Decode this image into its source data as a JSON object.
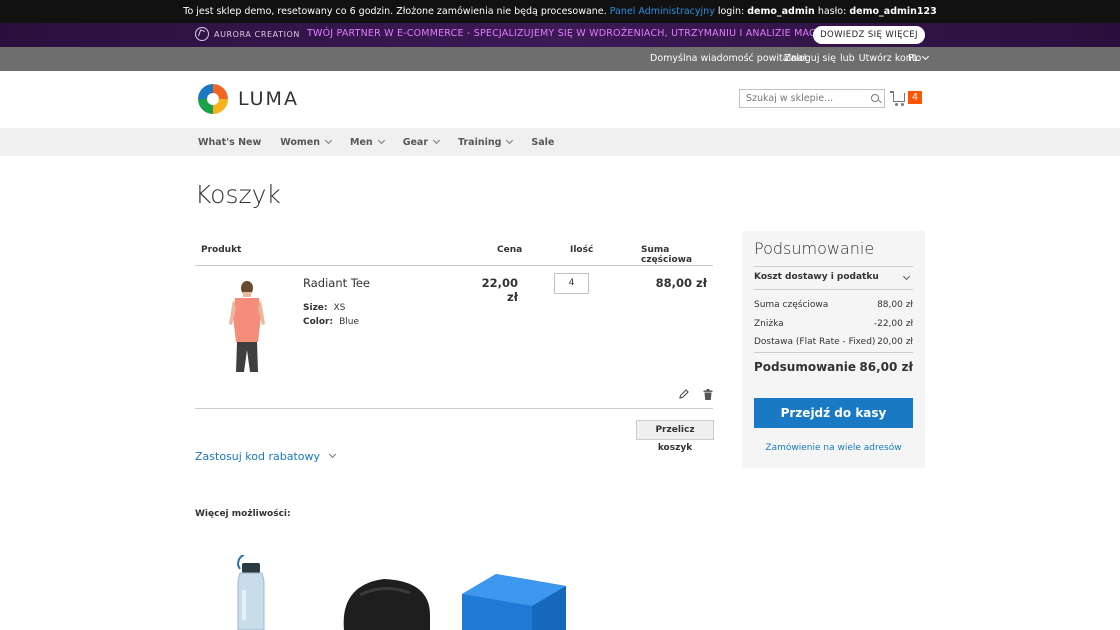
{
  "demo_notice": {
    "text_before": "To jest sklep demo, resetowany co 6 godzin. Złożone zamówienia nie będą procesowane.",
    "admin_link": "Panel Administracyjny",
    "login_label": "login:",
    "login_value": "demo_admin",
    "password_label": "hasło:",
    "password_value": "demo_admin123"
  },
  "promo": {
    "brand": "AURORA CREATION",
    "text": "TWÓJ PARTNER W E-COMMERCE - SPECJALIZUJEMY SIĘ W WDROŻENIACH, UTRZYMANIU I ANALIZIE MAGENTO",
    "button": "DOWIEDZ SIĘ WIĘCEJ"
  },
  "panel": {
    "welcome": "Domyślna wiadomość powitalna!",
    "sign_in": "Zaloguj się",
    "or": "lub",
    "create_account": "Utwórz konto",
    "language": "PL"
  },
  "header": {
    "logo_text": "LUMA",
    "search_placeholder": "Szukaj w sklepie...",
    "cart_count": "4"
  },
  "nav": {
    "items": [
      {
        "label": "What's New",
        "has_submenu": false
      },
      {
        "label": "Women",
        "has_submenu": true
      },
      {
        "label": "Men",
        "has_submenu": true
      },
      {
        "label": "Gear",
        "has_submenu": true
      },
      {
        "label": "Training",
        "has_submenu": true
      },
      {
        "label": "Sale",
        "has_submenu": false
      }
    ]
  },
  "page": {
    "title": "Koszyk"
  },
  "cart": {
    "headers": {
      "product": "Produkt",
      "price": "Cena",
      "qty": "Ilość",
      "subtotal": "Suma częściowa"
    },
    "item": {
      "name": "Radiant Tee",
      "size_label": "Size:",
      "size_value": "XS",
      "color_label": "Color:",
      "color_value": "Blue",
      "price": "22,00 zł",
      "qty": "4",
      "subtotal": "88,00 zł"
    },
    "update_button": "Przelicz koszyk",
    "discount_link": "Zastosuj kod rabatowy"
  },
  "summary": {
    "title": "Podsumowanie",
    "shipping_toggle": "Koszt dostawy i podatku",
    "rows": [
      {
        "label": "Suma częściowa",
        "value": "88,00 zł"
      },
      {
        "label": "Zniżka",
        "value": "-22,00 zł"
      },
      {
        "label": "Dostawa (Flat Rate - Fixed)",
        "value": "20,00 zł"
      }
    ],
    "total_label": "Podsumowanie",
    "total_value": "86,00 zł",
    "checkout_button": "Przejdź do kasy",
    "multi_address": "Zamówienie na wiele adresów"
  },
  "crosssell": {
    "title": "Więcej możliwości:"
  },
  "colors": {
    "accent_blue": "#1979c3",
    "cart_badge": "#ff5501",
    "promo_text": "#e27bff",
    "promo_bg": "#2a0f3d"
  }
}
